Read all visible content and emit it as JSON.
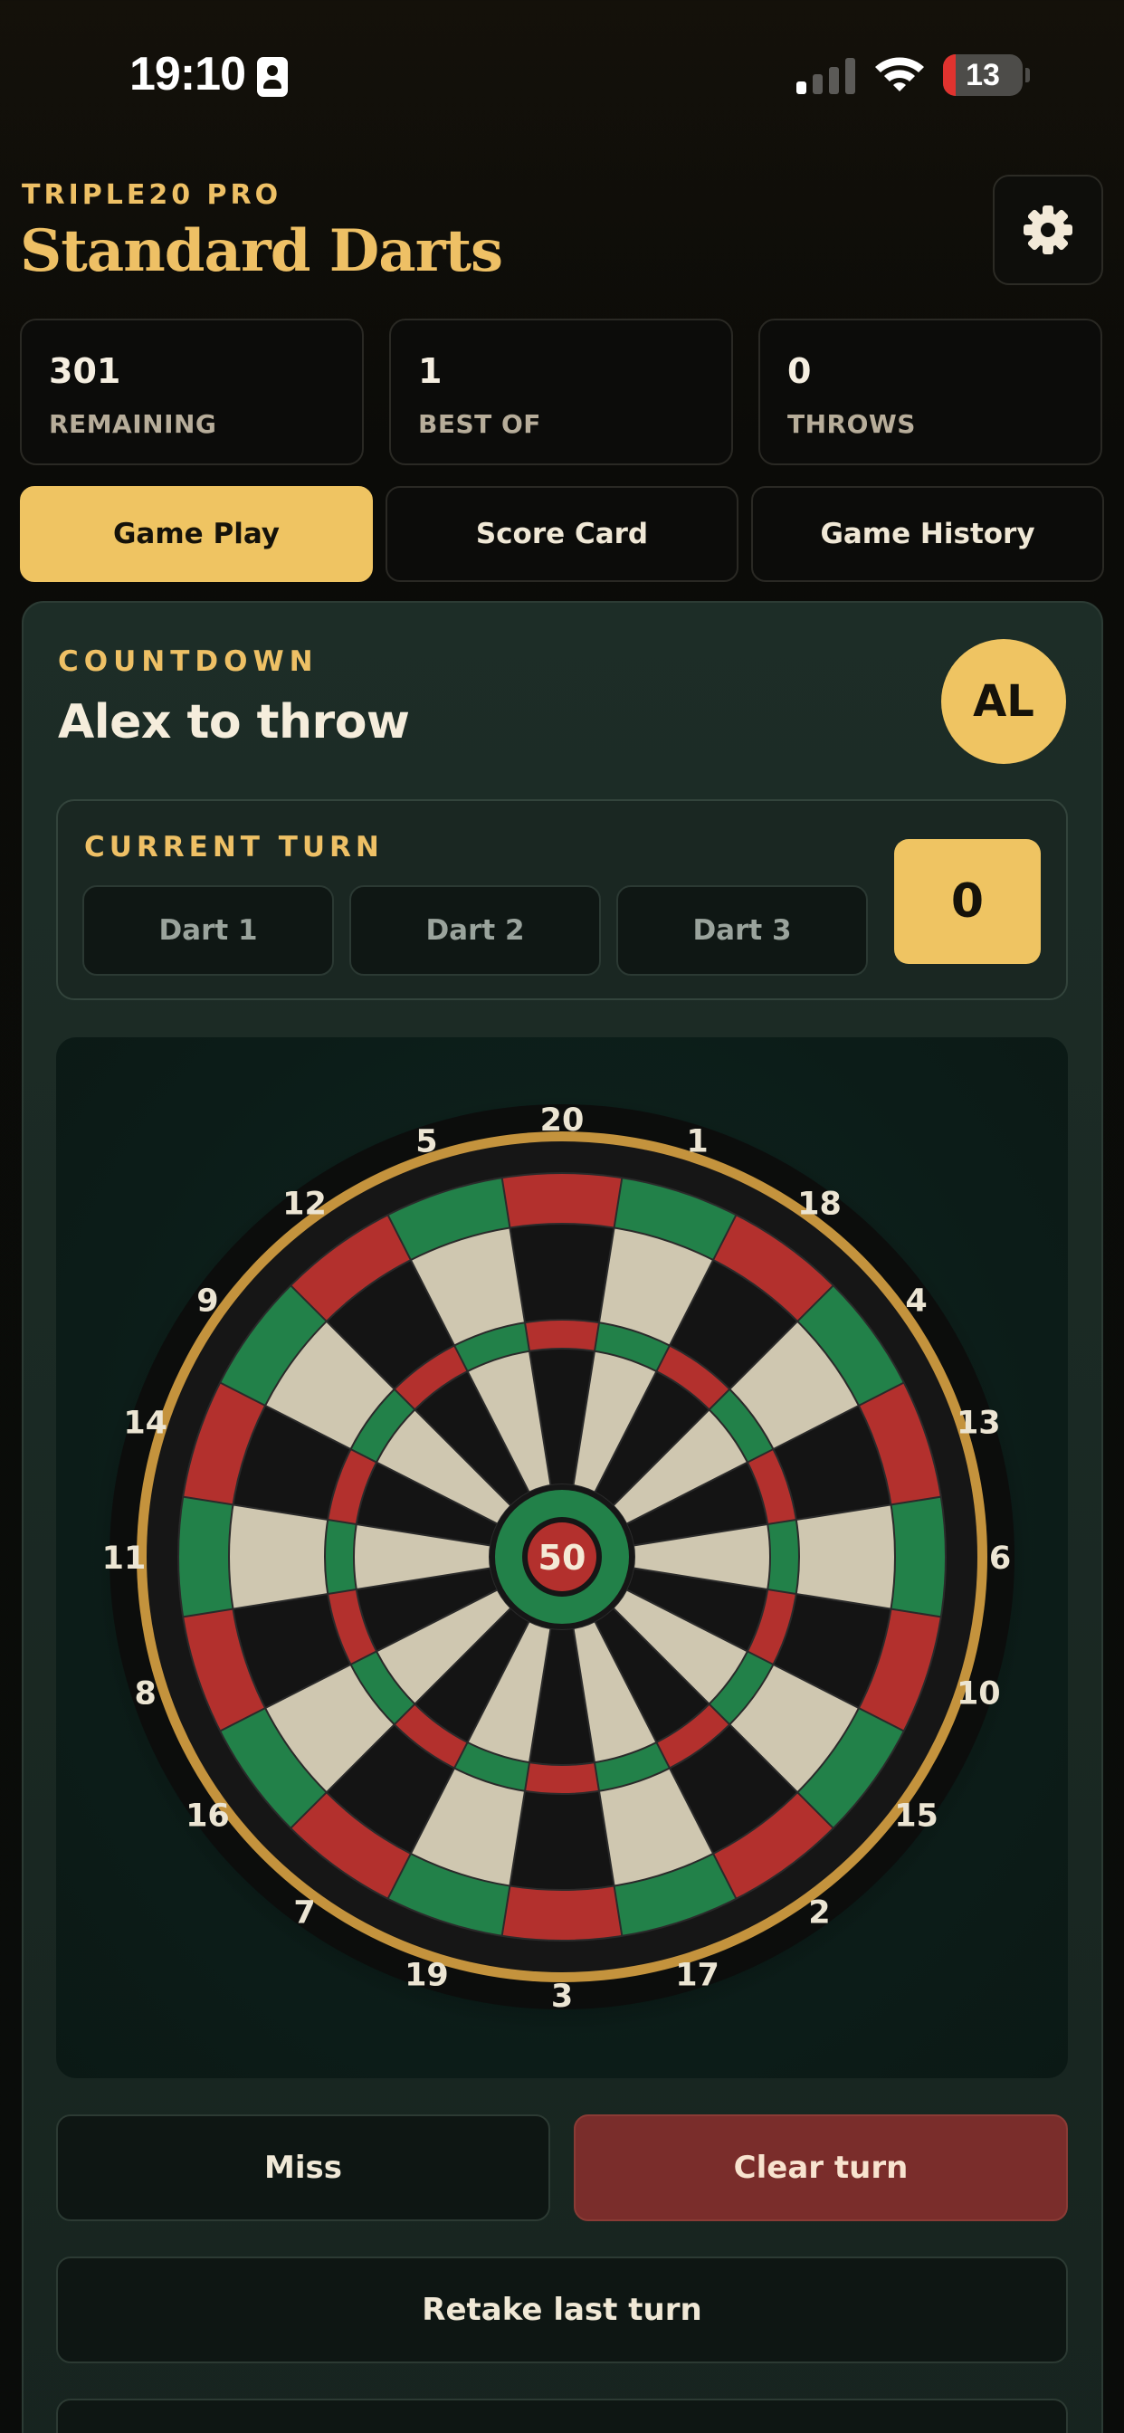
{
  "status_bar": {
    "time": "19:10",
    "battery": "13",
    "icons": [
      "id-card-icon",
      "cellular-signal-icon",
      "wifi-icon",
      "battery-icon"
    ]
  },
  "header": {
    "brand": "TRIPLE20 PRO",
    "title": "Standard Darts",
    "settings_icon": "gear-icon"
  },
  "stats": [
    {
      "value": "301",
      "label": "REMAINING"
    },
    {
      "value": "1",
      "label": "BEST OF"
    },
    {
      "value": "0",
      "label": "THROWS"
    }
  ],
  "tabs": [
    {
      "label": "Game Play",
      "active": true
    },
    {
      "label": "Score Card",
      "active": false
    },
    {
      "label": "Game History",
      "active": false
    }
  ],
  "game": {
    "mode": "COUNTDOWN",
    "turn_title": "Alex to throw",
    "player_initials": "AL",
    "current_turn_label": "CURRENT TURN",
    "darts": [
      "Dart 1",
      "Dart 2",
      "Dart 3"
    ],
    "turn_score": "0"
  },
  "dartboard": {
    "numbers": [
      "20",
      "1",
      "18",
      "4",
      "13",
      "6",
      "10",
      "15",
      "2",
      "17",
      "3",
      "19",
      "7",
      "16",
      "8",
      "11",
      "14",
      "9",
      "12",
      "5"
    ],
    "bullseye_label": "50",
    "colors": {
      "red": "#b3302d",
      "green": "#228149",
      "black": "#141414",
      "cream": "#cfc7b0",
      "rim": "#c4933d"
    }
  },
  "actions": {
    "miss": "Miss",
    "clear_turn": "Clear turn",
    "retake": "Retake last turn"
  },
  "colors": {
    "accent": "#efc462",
    "panel": "#1d2d27",
    "danger": "#7a2d2b"
  }
}
